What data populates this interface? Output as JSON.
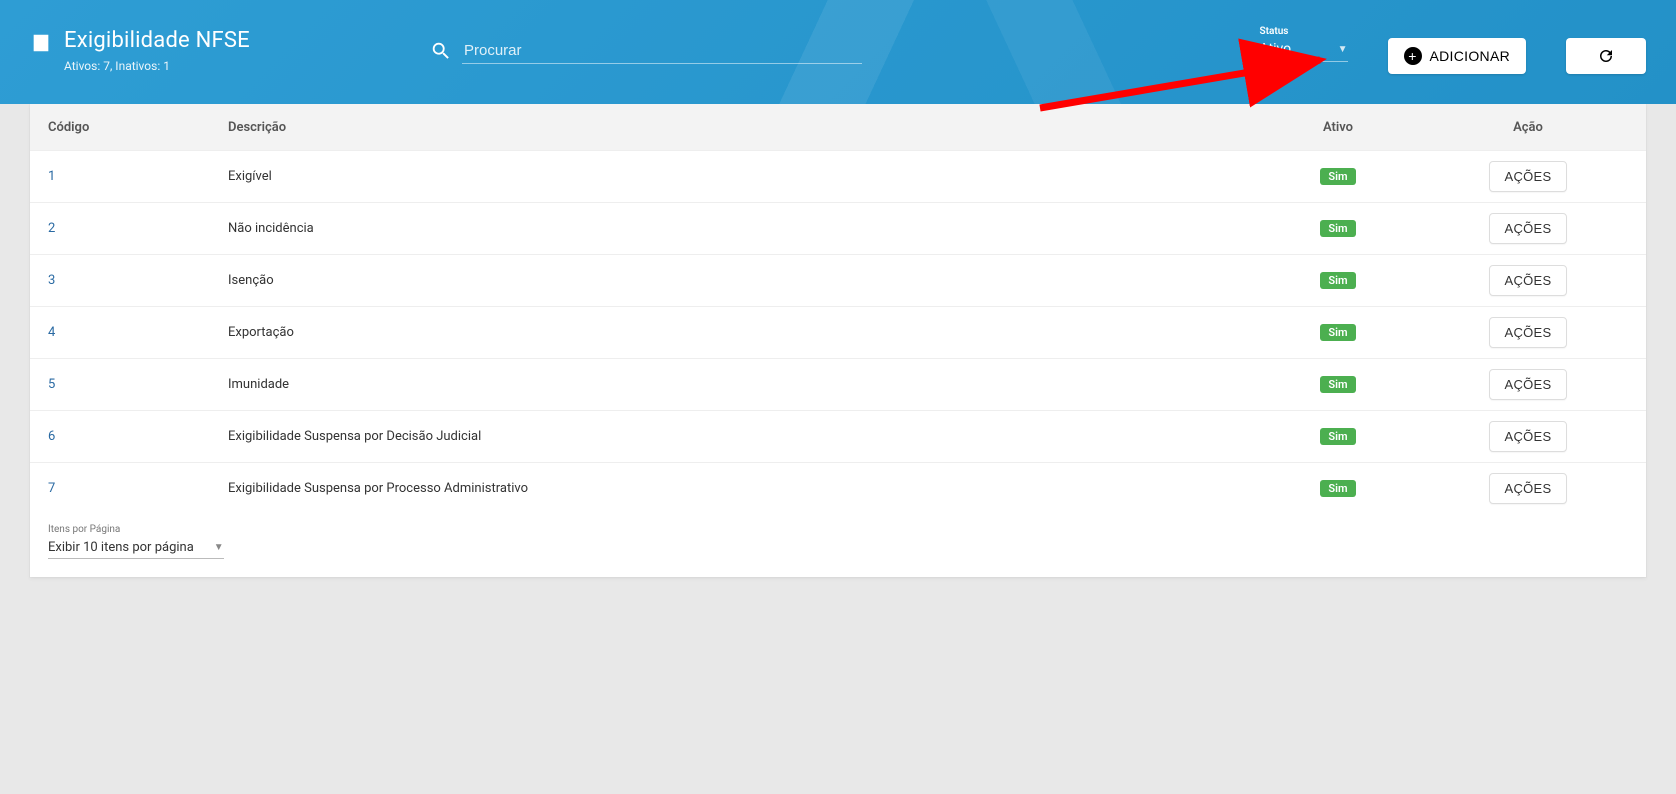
{
  "header": {
    "title": "Exigibilidade NFSE",
    "subtitle": "Ativos: 7, Inativos: 1",
    "search_placeholder": "Procurar",
    "status_label": "Status",
    "status_value": "Ativo",
    "add_label": "ADICIONAR"
  },
  "table": {
    "headers": {
      "codigo": "Código",
      "descricao": "Descrição",
      "ativo": "Ativo",
      "acao": "Ação"
    },
    "action_label": "AÇÕES",
    "active_badge": "Sim",
    "rows": [
      {
        "codigo": "1",
        "descricao": "Exigível"
      },
      {
        "codigo": "2",
        "descricao": "Não incidência"
      },
      {
        "codigo": "3",
        "descricao": "Isenção"
      },
      {
        "codigo": "4",
        "descricao": "Exportação"
      },
      {
        "codigo": "5",
        "descricao": "Imunidade"
      },
      {
        "codigo": "6",
        "descricao": "Exigibilidade Suspensa por Decisão Judicial"
      },
      {
        "codigo": "7",
        "descricao": "Exigibilidade Suspensa por Processo Administrativo"
      }
    ]
  },
  "footer": {
    "items_label": "Itens por Página",
    "items_value": "Exibir 10 itens por página"
  }
}
